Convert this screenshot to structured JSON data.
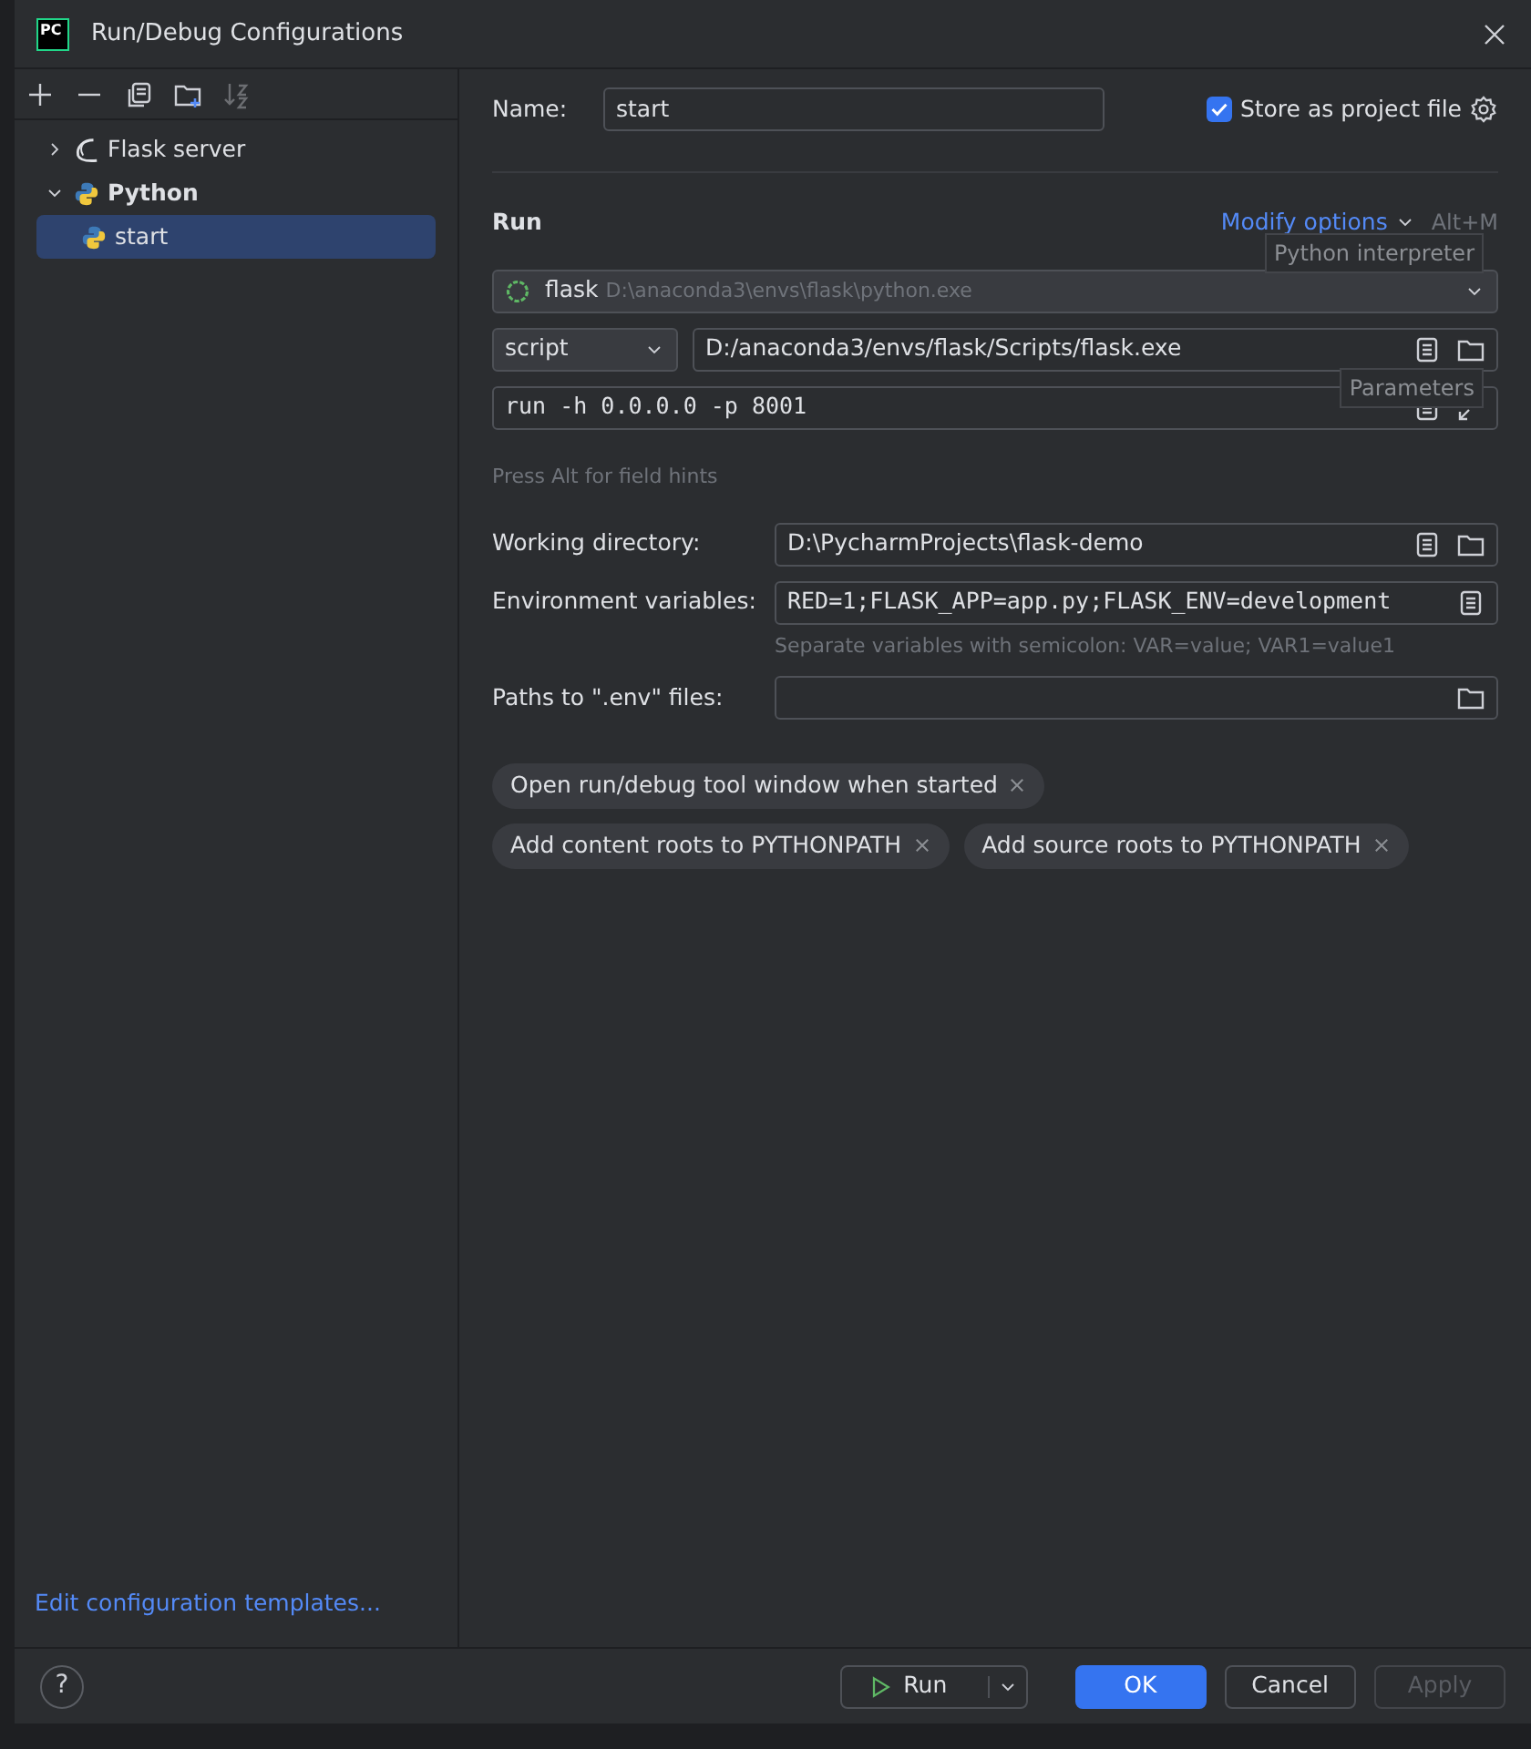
{
  "window": {
    "title": "Run/Debug Configurations",
    "logo": "PC"
  },
  "toolbar": [
    {
      "kind": "add",
      "disabled": false
    },
    {
      "kind": "remove",
      "disabled": false
    },
    {
      "kind": "copy",
      "disabled": false
    },
    {
      "kind": "folder",
      "disabled": false
    },
    {
      "kind": "sort",
      "disabled": true
    }
  ],
  "tree": [
    {
      "label": "Flask server",
      "kind": "flask",
      "expanded": false,
      "selected": false
    },
    {
      "label": "Python",
      "kind": "python",
      "expanded": true,
      "selected": false,
      "children": [
        {
          "label": "start",
          "kind": "python",
          "selected": true
        }
      ]
    }
  ],
  "templates_link": "Edit configuration templates...",
  "name": {
    "label": "Name:",
    "value": "start"
  },
  "store": {
    "label": "Store as project file",
    "checked": true
  },
  "run_section": {
    "title": "Run",
    "modify_options": "Modify options",
    "shortcut": "Alt+M"
  },
  "interpreter": {
    "name": "flask",
    "path": "D:\\anaconda3\\envs\\flask\\python.exe",
    "tooltip": "Python interpreter"
  },
  "script": {
    "mode": "script",
    "path": "D:/anaconda3/envs/flask/Scripts/flask.exe"
  },
  "parameters": {
    "value": "run -h 0.0.0.0 -p 8001",
    "tooltip": "Parameters"
  },
  "hint": "Press Alt for field hints",
  "fields": [
    {
      "label": "Working directory:",
      "value": "D:\\PycharmProjects\\flask-demo",
      "kind": "path"
    },
    {
      "label": "Environment variables:",
      "value": "RED=1;FLASK_APP=app.py;FLASK_ENV=development",
      "kind": "env",
      "hint": "Separate variables with semicolon: VAR=value; VAR1=value1"
    },
    {
      "label": "Paths to \".env\" files:",
      "kind": "files"
    }
  ],
  "chip_rows": [
    [
      "Open run/debug tool window when started"
    ],
    [
      "Add content roots to PYTHONPATH",
      "Add source roots to PYTHONPATH"
    ]
  ],
  "help": "?",
  "buttons": [
    {
      "kind": "run",
      "label": "Run",
      "disabled": false
    },
    {
      "kind": "primary",
      "label": "OK",
      "disabled": false
    },
    {
      "kind": "secondary",
      "label": "Cancel",
      "disabled": false
    },
    {
      "kind": "secondary",
      "label": "Apply",
      "disabled": true
    }
  ]
}
